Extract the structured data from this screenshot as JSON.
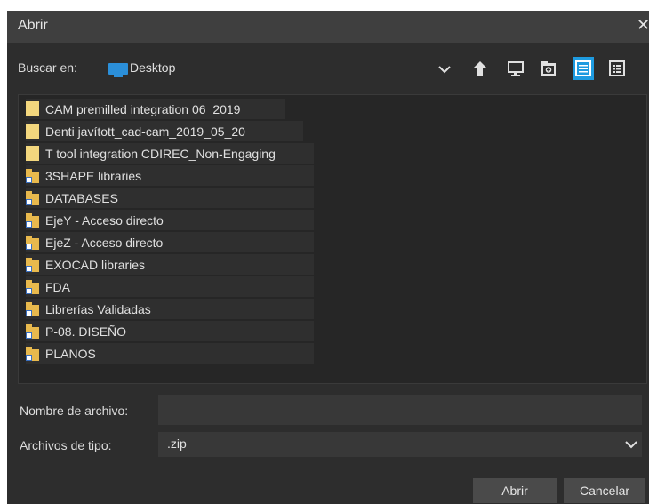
{
  "window": {
    "title": "Abrir",
    "close_icon": "close-icon"
  },
  "look_in": {
    "label": "Buscar en:",
    "value": "Desktop",
    "icon": "desktop-folder-icon"
  },
  "toolbar": {
    "icons": [
      "up-arrow-icon",
      "desktop-icon",
      "new-folder-icon",
      "list-view-icon",
      "details-view-icon"
    ],
    "active": "list-view-icon",
    "accent_color": "#1e9be0"
  },
  "files": [
    {
      "name": "CAM premilled integration 06_2019",
      "type": "folder"
    },
    {
      "name": "Denti javított_cad-cam_2019_05_20",
      "type": "folder"
    },
    {
      "name": "T tool integration CDIREC_Non-Engaging",
      "type": "folder"
    },
    {
      "name": "3SHAPE libraries",
      "type": "shortcut"
    },
    {
      "name": "DATABASES",
      "type": "shortcut"
    },
    {
      "name": "EjeY - Acceso directo",
      "type": "shortcut"
    },
    {
      "name": "EjeZ - Acceso directo",
      "type": "shortcut"
    },
    {
      "name": "EXOCAD libraries",
      "type": "shortcut"
    },
    {
      "name": "FDA",
      "type": "shortcut"
    },
    {
      "name": "Librerías Validadas",
      "type": "shortcut"
    },
    {
      "name": "P-08. DISEÑO",
      "type": "shortcut"
    },
    {
      "name": "PLANOS",
      "type": "shortcut"
    }
  ],
  "filename": {
    "label": "Nombre de archivo:",
    "value": ""
  },
  "filetype": {
    "label": "Archivos de tipo:",
    "value": ".zip"
  },
  "buttons": {
    "open": "Abrir",
    "cancel": "Cancelar"
  }
}
